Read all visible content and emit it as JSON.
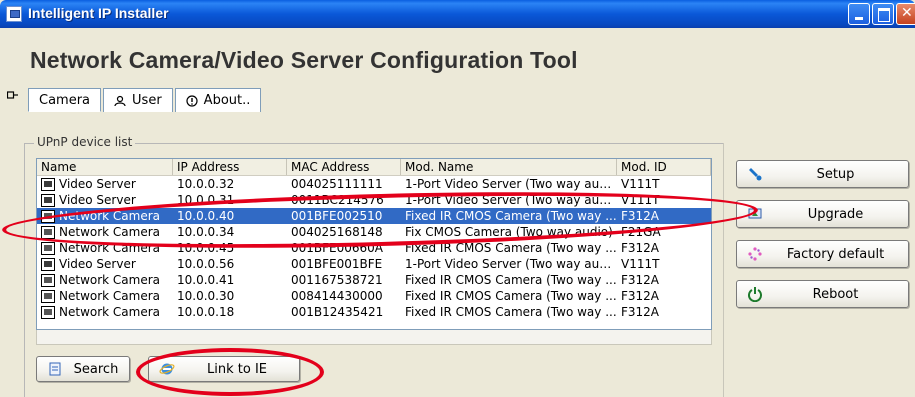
{
  "window": {
    "title": "Intelligent IP Installer"
  },
  "header": {
    "title": "Network Camera/Video Server Configuration Tool"
  },
  "tabs": [
    {
      "label": "Camera",
      "icon": "camera-icon",
      "active": true
    },
    {
      "label": "User",
      "icon": "user-icon",
      "active": false
    },
    {
      "label": "About..",
      "icon": "info-icon",
      "active": false
    }
  ],
  "group": {
    "label": "UPnP device list"
  },
  "list": {
    "columns": [
      "Name",
      "IP Address",
      "MAC Address",
      "Mod. Name",
      "Mod. ID"
    ],
    "rows": [
      [
        "Video Server",
        "10.0.0.32",
        "004025111111",
        "1-Port Video Server (Two way audi...",
        "V111T"
      ],
      [
        "Video Server",
        "10.0.0.31",
        "0011BC214576",
        "1-Port Video Server (Two way audi...",
        "V111T"
      ],
      [
        "Network Camera",
        "10.0.0.40",
        "001BFE002510",
        "Fixed IR CMOS Camera (Two way ...",
        "F312A"
      ],
      [
        "Network Camera",
        "10.0.0.34",
        "004025168148",
        "Fix CMOS Camera (Two way audio)",
        "F21GA"
      ],
      [
        "Network Camera",
        "10.0.0.45",
        "001BFE00660A",
        "Fixed IR CMOS Camera (Two way ...",
        "F312A"
      ],
      [
        "Video Server",
        "10.0.0.56",
        "001BFE001BFE",
        "1-Port Video Server (Two way audi...",
        "V111T"
      ],
      [
        "Network Camera",
        "10.0.0.41",
        "001167538721",
        "Fixed IR CMOS Camera (Two way ...",
        "F312A"
      ],
      [
        "Network Camera",
        "10.0.0.30",
        "008414430000",
        "Fixed IR CMOS Camera (Two way ...",
        "F312A"
      ],
      [
        "Network Camera",
        "10.0.0.18",
        "001B12435421",
        "Fixed IR CMOS Camera (Two way ...",
        "F312A"
      ]
    ],
    "selected_index": 2
  },
  "buttons": {
    "setup": "Setup",
    "upgrade": "Upgrade",
    "factory_default": "Factory default",
    "reboot": "Reboot",
    "search": "Search",
    "link_to_ie": "Link to IE"
  },
  "colors": {
    "selection": "#316ac5",
    "annotation": "#e3001b",
    "titlebar": "#0a58d8"
  }
}
